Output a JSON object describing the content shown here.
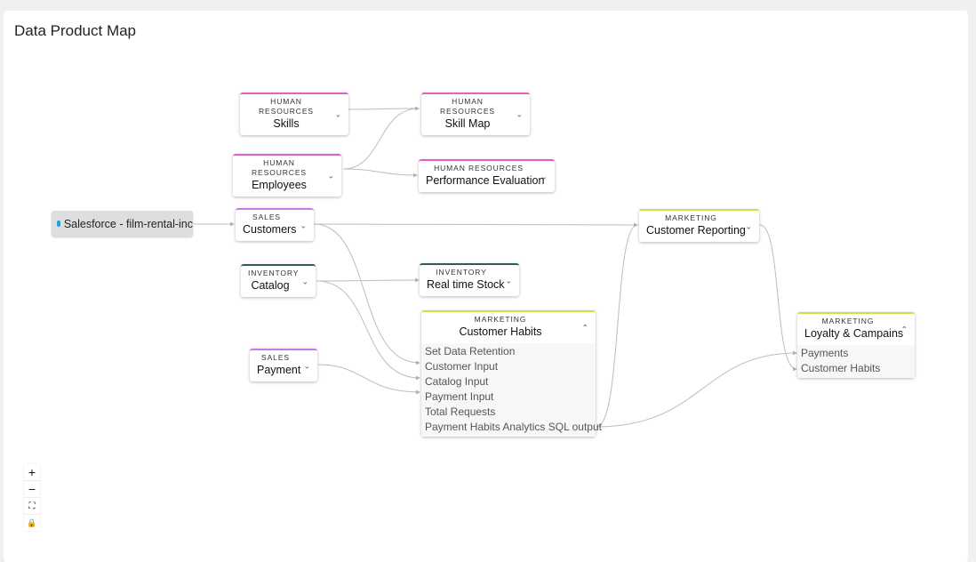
{
  "page": {
    "title": "Data Product Map"
  },
  "colors": {
    "human_resources": "#e35fc2",
    "sales": "#c57be8",
    "inventory": "#2f5a5e",
    "marketing": "#c6e44a",
    "edge": "#b5b5b5",
    "source_bg": "#dedede",
    "salesforce_icon": "#1aa3e8"
  },
  "source": {
    "label": "Salesforce - film-rental-inc",
    "icon": "salesforce-cloud-icon"
  },
  "nodes": {
    "skills": {
      "domain": "HUMAN RESOURCES",
      "name": "Skills",
      "expanded": false
    },
    "skill_map": {
      "domain": "HUMAN RESOURCES",
      "name": "Skill Map",
      "expanded": false
    },
    "employees": {
      "domain": "HUMAN RESOURCES",
      "name": "Employees",
      "expanded": false
    },
    "performance_evaluation": {
      "domain": "HUMAN RESOURCES",
      "name": "Performance Evaluation",
      "expanded": false
    },
    "customers": {
      "domain": "SALES",
      "name": "Customers",
      "expanded": false
    },
    "catalog": {
      "domain": "INVENTORY",
      "name": "Catalog",
      "expanded": false
    },
    "real_time_stock": {
      "domain": "INVENTORY",
      "name": "Real time Stock",
      "expanded": false
    },
    "payment": {
      "domain": "SALES",
      "name": "Payment",
      "expanded": false
    },
    "customer_habits": {
      "domain": "MARKETING",
      "name": "Customer Habits",
      "expanded": true,
      "ports": [
        "Set Data Retention",
        "Customer Input",
        "Catalog Input",
        "Payment Input",
        "Total Requests",
        "Payment Habits Analytics SQL output"
      ]
    },
    "customer_reporting": {
      "domain": "MARKETING",
      "name": "Customer Reporting",
      "expanded": false
    },
    "loyalty_campains": {
      "domain": "MARKETING",
      "name": "Loyalty & Campains",
      "expanded": true,
      "ports": [
        "Payments",
        "Customer Habits"
      ]
    }
  },
  "edges": [
    {
      "from": "skills",
      "to": "skill_map"
    },
    {
      "from": "employees",
      "to": "skill_map"
    },
    {
      "from": "employees",
      "to": "performance_evaluation"
    },
    {
      "from": "salesforce-source",
      "to": "customers"
    },
    {
      "from": "customers",
      "to": "customer_reporting"
    },
    {
      "from": "customers",
      "to": "customer_habits.Customer Input"
    },
    {
      "from": "catalog",
      "to": "real_time_stock"
    },
    {
      "from": "catalog",
      "to": "customer_habits.Catalog Input"
    },
    {
      "from": "payment",
      "to": "customer_habits.Payment Input"
    },
    {
      "from": "customer_habits.Payment Habits Analytics SQL output",
      "to": "customer_reporting"
    },
    {
      "from": "customer_habits.Payment Habits Analytics SQL output",
      "to": "loyalty_campains.Payments"
    },
    {
      "from": "customer_reporting",
      "to": "loyalty_campains.Customer Habits"
    }
  ],
  "controls": {
    "zoom_in": "+",
    "zoom_out": "−",
    "fit_view": "⛶",
    "lock": "🔒"
  }
}
